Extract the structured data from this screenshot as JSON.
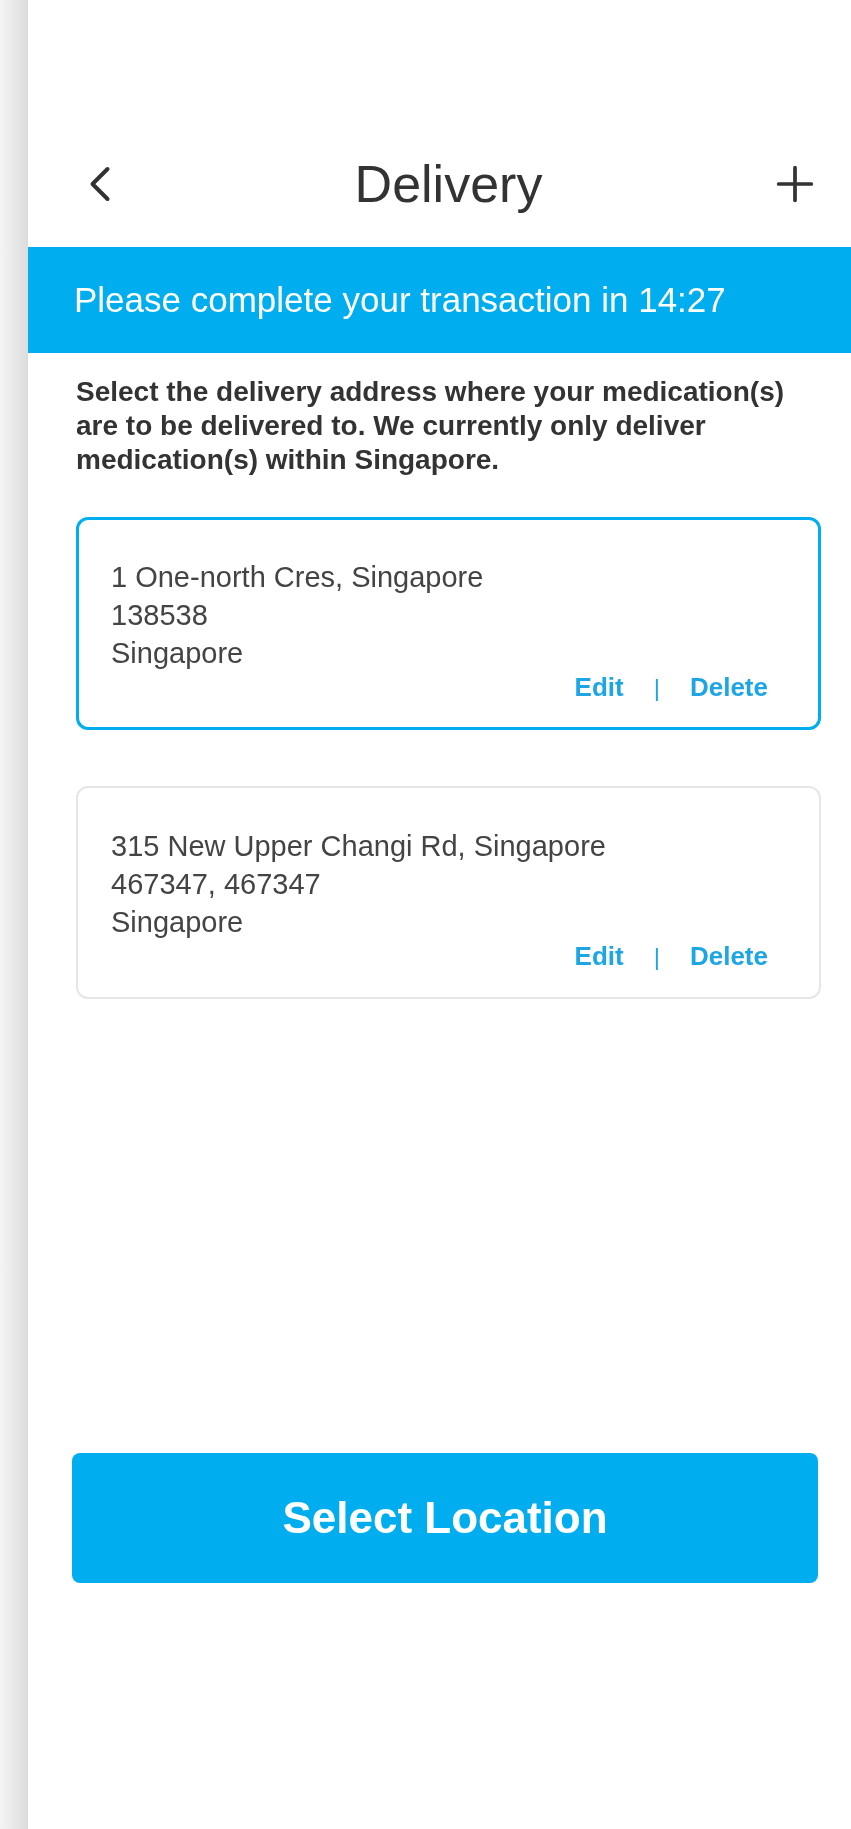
{
  "header": {
    "title": "Delivery"
  },
  "banner": {
    "text": "Please complete your transaction in 14:27"
  },
  "intro": "Select the delivery address where your medication(s) are to be delivered to. We currently only deliver medication(s) within Singapore.",
  "addresses": [
    {
      "lines": [
        "1 One-north Cres, Singapore",
        "138538",
        "Singapore"
      ],
      "selected": true,
      "edit": "Edit",
      "separator": "|",
      "delete": "Delete"
    },
    {
      "lines": [
        "315 New Upper Changi Rd, Singapore",
        "467347, 467347",
        "Singapore"
      ],
      "selected": false,
      "edit": "Edit",
      "separator": "|",
      "delete": "Delete"
    }
  ],
  "button": {
    "label": "Select Location"
  }
}
